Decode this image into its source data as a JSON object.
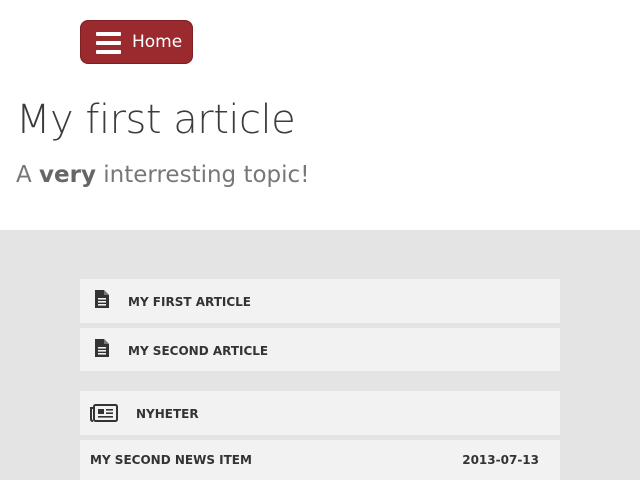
{
  "nav": {
    "home_label": "Home"
  },
  "article": {
    "title": "My first article",
    "subtitle_prefix": "A ",
    "subtitle_emphasis": "very",
    "subtitle_suffix": " interresting topic!"
  },
  "links": [
    {
      "label": "MY FIRST ARTICLE",
      "icon": "document-icon"
    },
    {
      "label": "MY SECOND ARTICLE",
      "icon": "document-icon"
    }
  ],
  "news": {
    "heading": "NYHETER",
    "icon": "newspaper-icon",
    "items": [
      {
        "title": "MY SECOND NEWS ITEM",
        "date": "2013-07-13"
      }
    ]
  },
  "colors": {
    "accent": "#9b2a2e",
    "panel_bg": "#e4e4e4",
    "row_bg": "#f2f2f2"
  }
}
